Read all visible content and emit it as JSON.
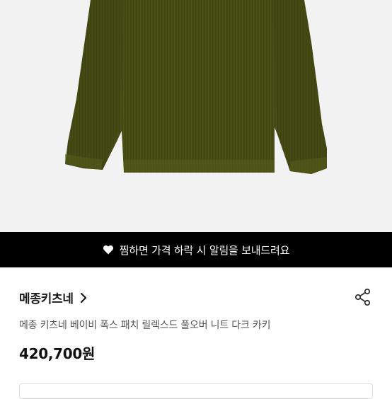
{
  "product_image": {
    "alt": "",
    "colors": {
      "background": "#f2f2f2",
      "sweater": "#4a4f16",
      "sweater_shadow": "#3d4211",
      "sweater_rib": "#565b1d"
    }
  },
  "wish_banner": {
    "icon": "heart-icon",
    "text": "찜하면 가격 하락 시 알림을 보내드려요"
  },
  "brand": {
    "name": "메종키츠네",
    "chevron_icon": "chevron-right-icon"
  },
  "share": {
    "icon": "share-icon"
  },
  "product": {
    "title": "메종 키츠네 베이비 폭스 패치 릴렉스드 풀오버 니트 다크 카키",
    "price": "420,700원"
  },
  "colors": {
    "banner_bg": "#000000",
    "banner_text": "#ffffff",
    "text_primary": "#111111",
    "text_secondary": "#555555"
  }
}
